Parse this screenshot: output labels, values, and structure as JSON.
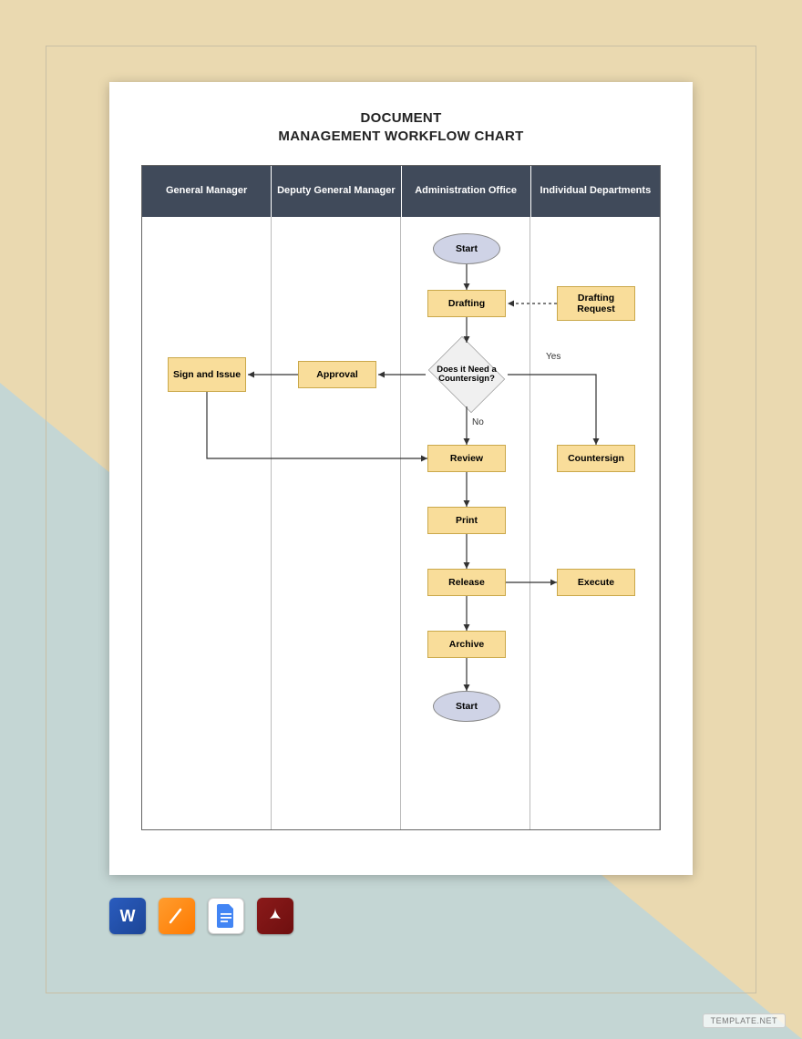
{
  "title_line1": "DOCUMENT",
  "title_line2": "MANAGEMENT WORKFLOW CHART",
  "lanes": [
    "General Manager",
    "Deputy General Manager",
    "Administration Office",
    "Individual Departments"
  ],
  "nodes": {
    "start": "Start",
    "drafting": "Drafting",
    "drafting_request": "Drafting Request",
    "decision": "Does it Need a Countersign?",
    "approval": "Approval",
    "sign_issue": "Sign and Issue",
    "countersign": "Countersign",
    "review": "Review",
    "print": "Print",
    "release": "Release",
    "execute": "Execute",
    "archive": "Archive",
    "end": "Start"
  },
  "labels": {
    "yes": "Yes",
    "no": "No"
  },
  "icons": [
    "word",
    "pages",
    "gdoc",
    "pdf"
  ],
  "watermark": "TEMPLATE.NET",
  "chart_data": {
    "type": "flowchart-swimlane",
    "lanes": [
      "General Manager",
      "Deputy General Manager",
      "Administration Office",
      "Individual Departments"
    ],
    "nodes": [
      {
        "id": "start",
        "lane": "Administration Office",
        "shape": "terminator",
        "label": "Start"
      },
      {
        "id": "drafting",
        "lane": "Administration Office",
        "shape": "process",
        "label": "Drafting"
      },
      {
        "id": "drafting_request",
        "lane": "Individual Departments",
        "shape": "process",
        "label": "Drafting Request"
      },
      {
        "id": "decision",
        "lane": "Administration Office",
        "shape": "decision",
        "label": "Does it Need a Countersign?"
      },
      {
        "id": "approval",
        "lane": "Deputy General Manager",
        "shape": "process",
        "label": "Approval"
      },
      {
        "id": "sign_issue",
        "lane": "General Manager",
        "shape": "process",
        "label": "Sign and Issue"
      },
      {
        "id": "countersign",
        "lane": "Individual Departments",
        "shape": "process",
        "label": "Countersign"
      },
      {
        "id": "review",
        "lane": "Administration Office",
        "shape": "process",
        "label": "Review"
      },
      {
        "id": "print",
        "lane": "Administration Office",
        "shape": "process",
        "label": "Print"
      },
      {
        "id": "release",
        "lane": "Administration Office",
        "shape": "process",
        "label": "Release"
      },
      {
        "id": "execute",
        "lane": "Individual Departments",
        "shape": "process",
        "label": "Execute"
      },
      {
        "id": "archive",
        "lane": "Administration Office",
        "shape": "process",
        "label": "Archive"
      },
      {
        "id": "end",
        "lane": "Administration Office",
        "shape": "terminator",
        "label": "Start"
      }
    ],
    "edges": [
      {
        "from": "start",
        "to": "drafting"
      },
      {
        "from": "drafting_request",
        "to": "drafting",
        "style": "dashed"
      },
      {
        "from": "drafting",
        "to": "decision"
      },
      {
        "from": "decision",
        "to": "approval"
      },
      {
        "from": "approval",
        "to": "sign_issue"
      },
      {
        "from": "decision",
        "to": "countersign",
        "label": "Yes"
      },
      {
        "from": "decision",
        "to": "review",
        "label": "No"
      },
      {
        "from": "sign_issue",
        "to": "review"
      },
      {
        "from": "countersign",
        "to": "review"
      },
      {
        "from": "review",
        "to": "print"
      },
      {
        "from": "print",
        "to": "release"
      },
      {
        "from": "release",
        "to": "execute"
      },
      {
        "from": "release",
        "to": "archive"
      },
      {
        "from": "archive",
        "to": "end"
      }
    ]
  }
}
